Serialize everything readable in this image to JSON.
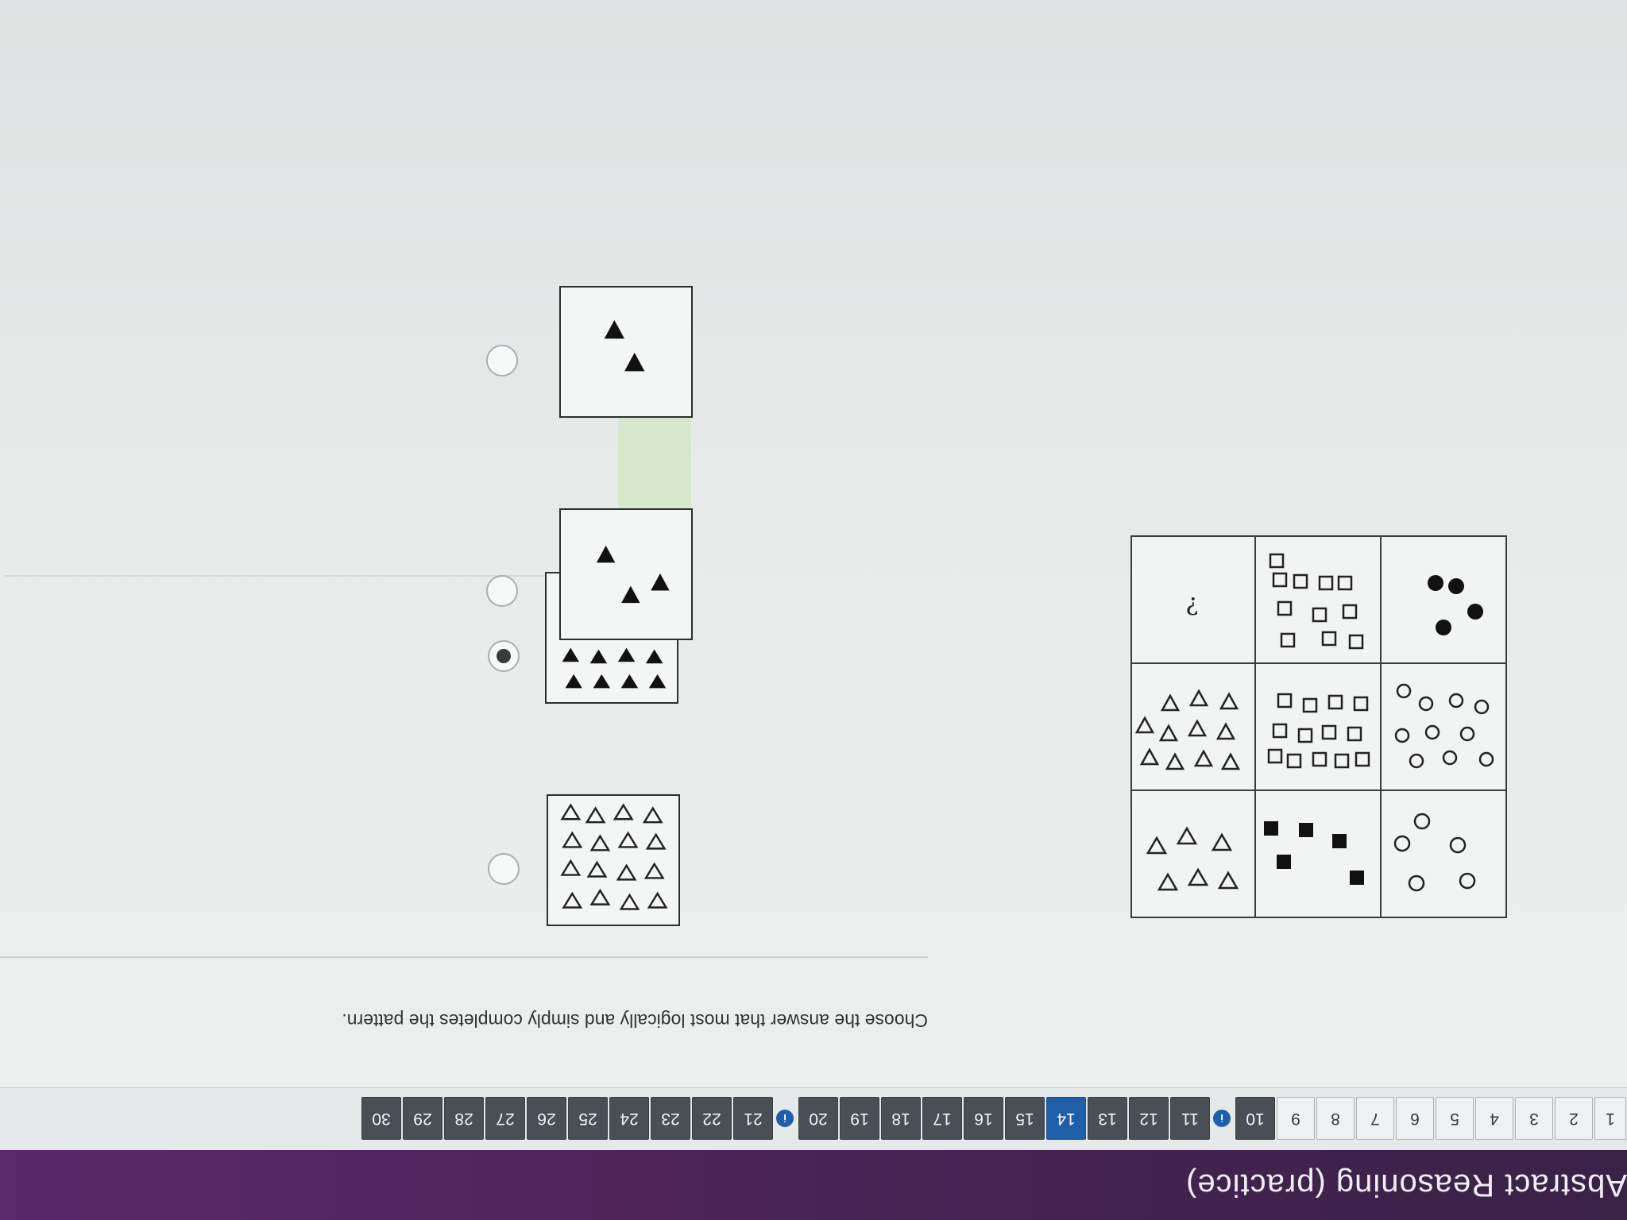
{
  "header": {
    "title": "Abstract Reasoning (practice)"
  },
  "nav": {
    "items": [
      {
        "label": "1"
      },
      {
        "label": "2"
      },
      {
        "label": "3"
      },
      {
        "label": "4"
      },
      {
        "label": "5"
      },
      {
        "label": "6"
      },
      {
        "label": "7"
      },
      {
        "label": "8"
      },
      {
        "label": "9"
      },
      {
        "label": "10"
      },
      {
        "label": "11"
      },
      {
        "label": "12"
      },
      {
        "label": "13"
      },
      {
        "label": "14"
      },
      {
        "label": "15"
      },
      {
        "label": "16"
      },
      {
        "label": "17"
      },
      {
        "label": "18"
      },
      {
        "label": "19"
      },
      {
        "label": "20"
      },
      {
        "label": "21"
      },
      {
        "label": "22"
      },
      {
        "label": "23"
      },
      {
        "label": "24"
      },
      {
        "label": "25"
      },
      {
        "label": "26"
      },
      {
        "label": "27"
      },
      {
        "label": "28"
      },
      {
        "label": "29"
      },
      {
        "label": "30"
      }
    ],
    "current": "14",
    "flag_icon": "info-flag-icon",
    "accent_color": "#1f5ea8"
  },
  "question": {
    "prompt": "Choose the answer that most logically and simply completes the pattern.",
    "missing_cell_symbol": "?"
  },
  "answers": {
    "selected_index": 1
  }
}
